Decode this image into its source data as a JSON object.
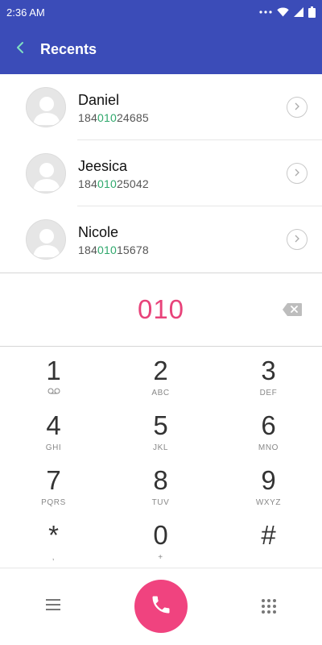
{
  "status_bar": {
    "time": "2:36 AM"
  },
  "header": {
    "title": "Recents"
  },
  "recents": [
    {
      "name": "Daniel",
      "number_prefix": "184",
      "number_match": "010",
      "number_suffix": "24685"
    },
    {
      "name": "Jeesica",
      "number_prefix": "184",
      "number_match": "010",
      "number_suffix": "25042"
    },
    {
      "name": "Nicole",
      "number_prefix": "184",
      "number_match": "010",
      "number_suffix": "15678"
    }
  ],
  "dialer": {
    "input": "010"
  },
  "keys": [
    {
      "digit": "1",
      "letters": ""
    },
    {
      "digit": "2",
      "letters": "ABC"
    },
    {
      "digit": "3",
      "letters": "DEF"
    },
    {
      "digit": "4",
      "letters": "GHI"
    },
    {
      "digit": "5",
      "letters": "JKL"
    },
    {
      "digit": "6",
      "letters": "MNO"
    },
    {
      "digit": "7",
      "letters": "PQRS"
    },
    {
      "digit": "8",
      "letters": "TUV"
    },
    {
      "digit": "9",
      "letters": "WXYZ"
    },
    {
      "digit": "*",
      "letters": ","
    },
    {
      "digit": "0",
      "letters": "+"
    },
    {
      "digit": "#",
      "letters": ""
    }
  ],
  "colors": {
    "primary": "#3b4cb8",
    "accent": "#e8437a",
    "call": "#f0437f",
    "match": "#2fa86c"
  },
  "icons": {
    "back": "chevron-left-icon",
    "detail": "chevron-right-circle-icon",
    "backspace": "backspace-icon",
    "voicemail": "voicemail-icon",
    "menu": "hamburger-icon",
    "call": "phone-icon",
    "keypad": "dialpad-icon"
  }
}
